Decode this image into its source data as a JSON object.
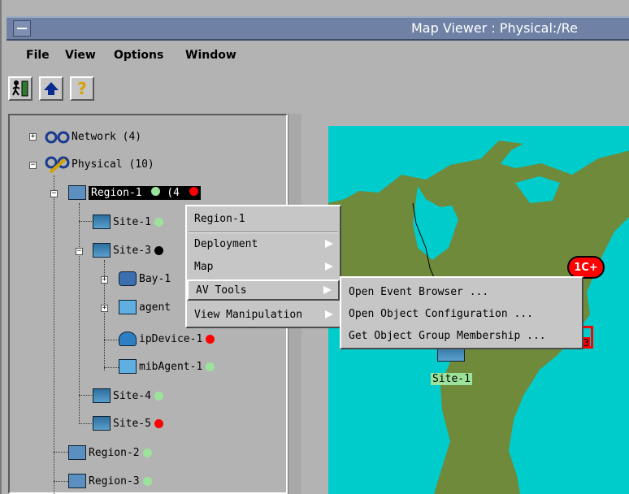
{
  "window": {
    "title": "Map Viewer : Physical:/Re"
  },
  "menubar": [
    "File",
    "View",
    "Options",
    "Window"
  ],
  "toolbar": {
    "icons": [
      "exit-icon",
      "up-arrow-icon",
      "help-icon"
    ],
    "help_glyph": "?"
  },
  "tree": {
    "network": "Network (4)",
    "physical": "Physical (10)",
    "region1": "Region-1",
    "region1_count": "(4",
    "site1": "Site-1",
    "site3": "Site-3",
    "bay1": "Bay-1",
    "agent": "agent",
    "ipdevice": "ipDevice-1",
    "mibagent": "mibAgent-1",
    "site4": "Site-4",
    "site5": "Site-5",
    "region2": "Region-2",
    "region3": "Region-3"
  },
  "context_menu": {
    "header": "Region-1",
    "items": [
      "Deployment",
      "Map",
      "AV Tools",
      "View Manipulation"
    ]
  },
  "submenu": {
    "items": [
      "Open Event Browser ...",
      "Open Object Configuration ...",
      "Get Object Group Membership ..."
    ]
  },
  "map": {
    "site_label": "Site-1",
    "alarm_badge": "1C+",
    "badge_number": "3"
  },
  "colors": {
    "ocean": "#00cccc",
    "land": "#6f8a3a",
    "title_bar": "#6f82a6"
  }
}
